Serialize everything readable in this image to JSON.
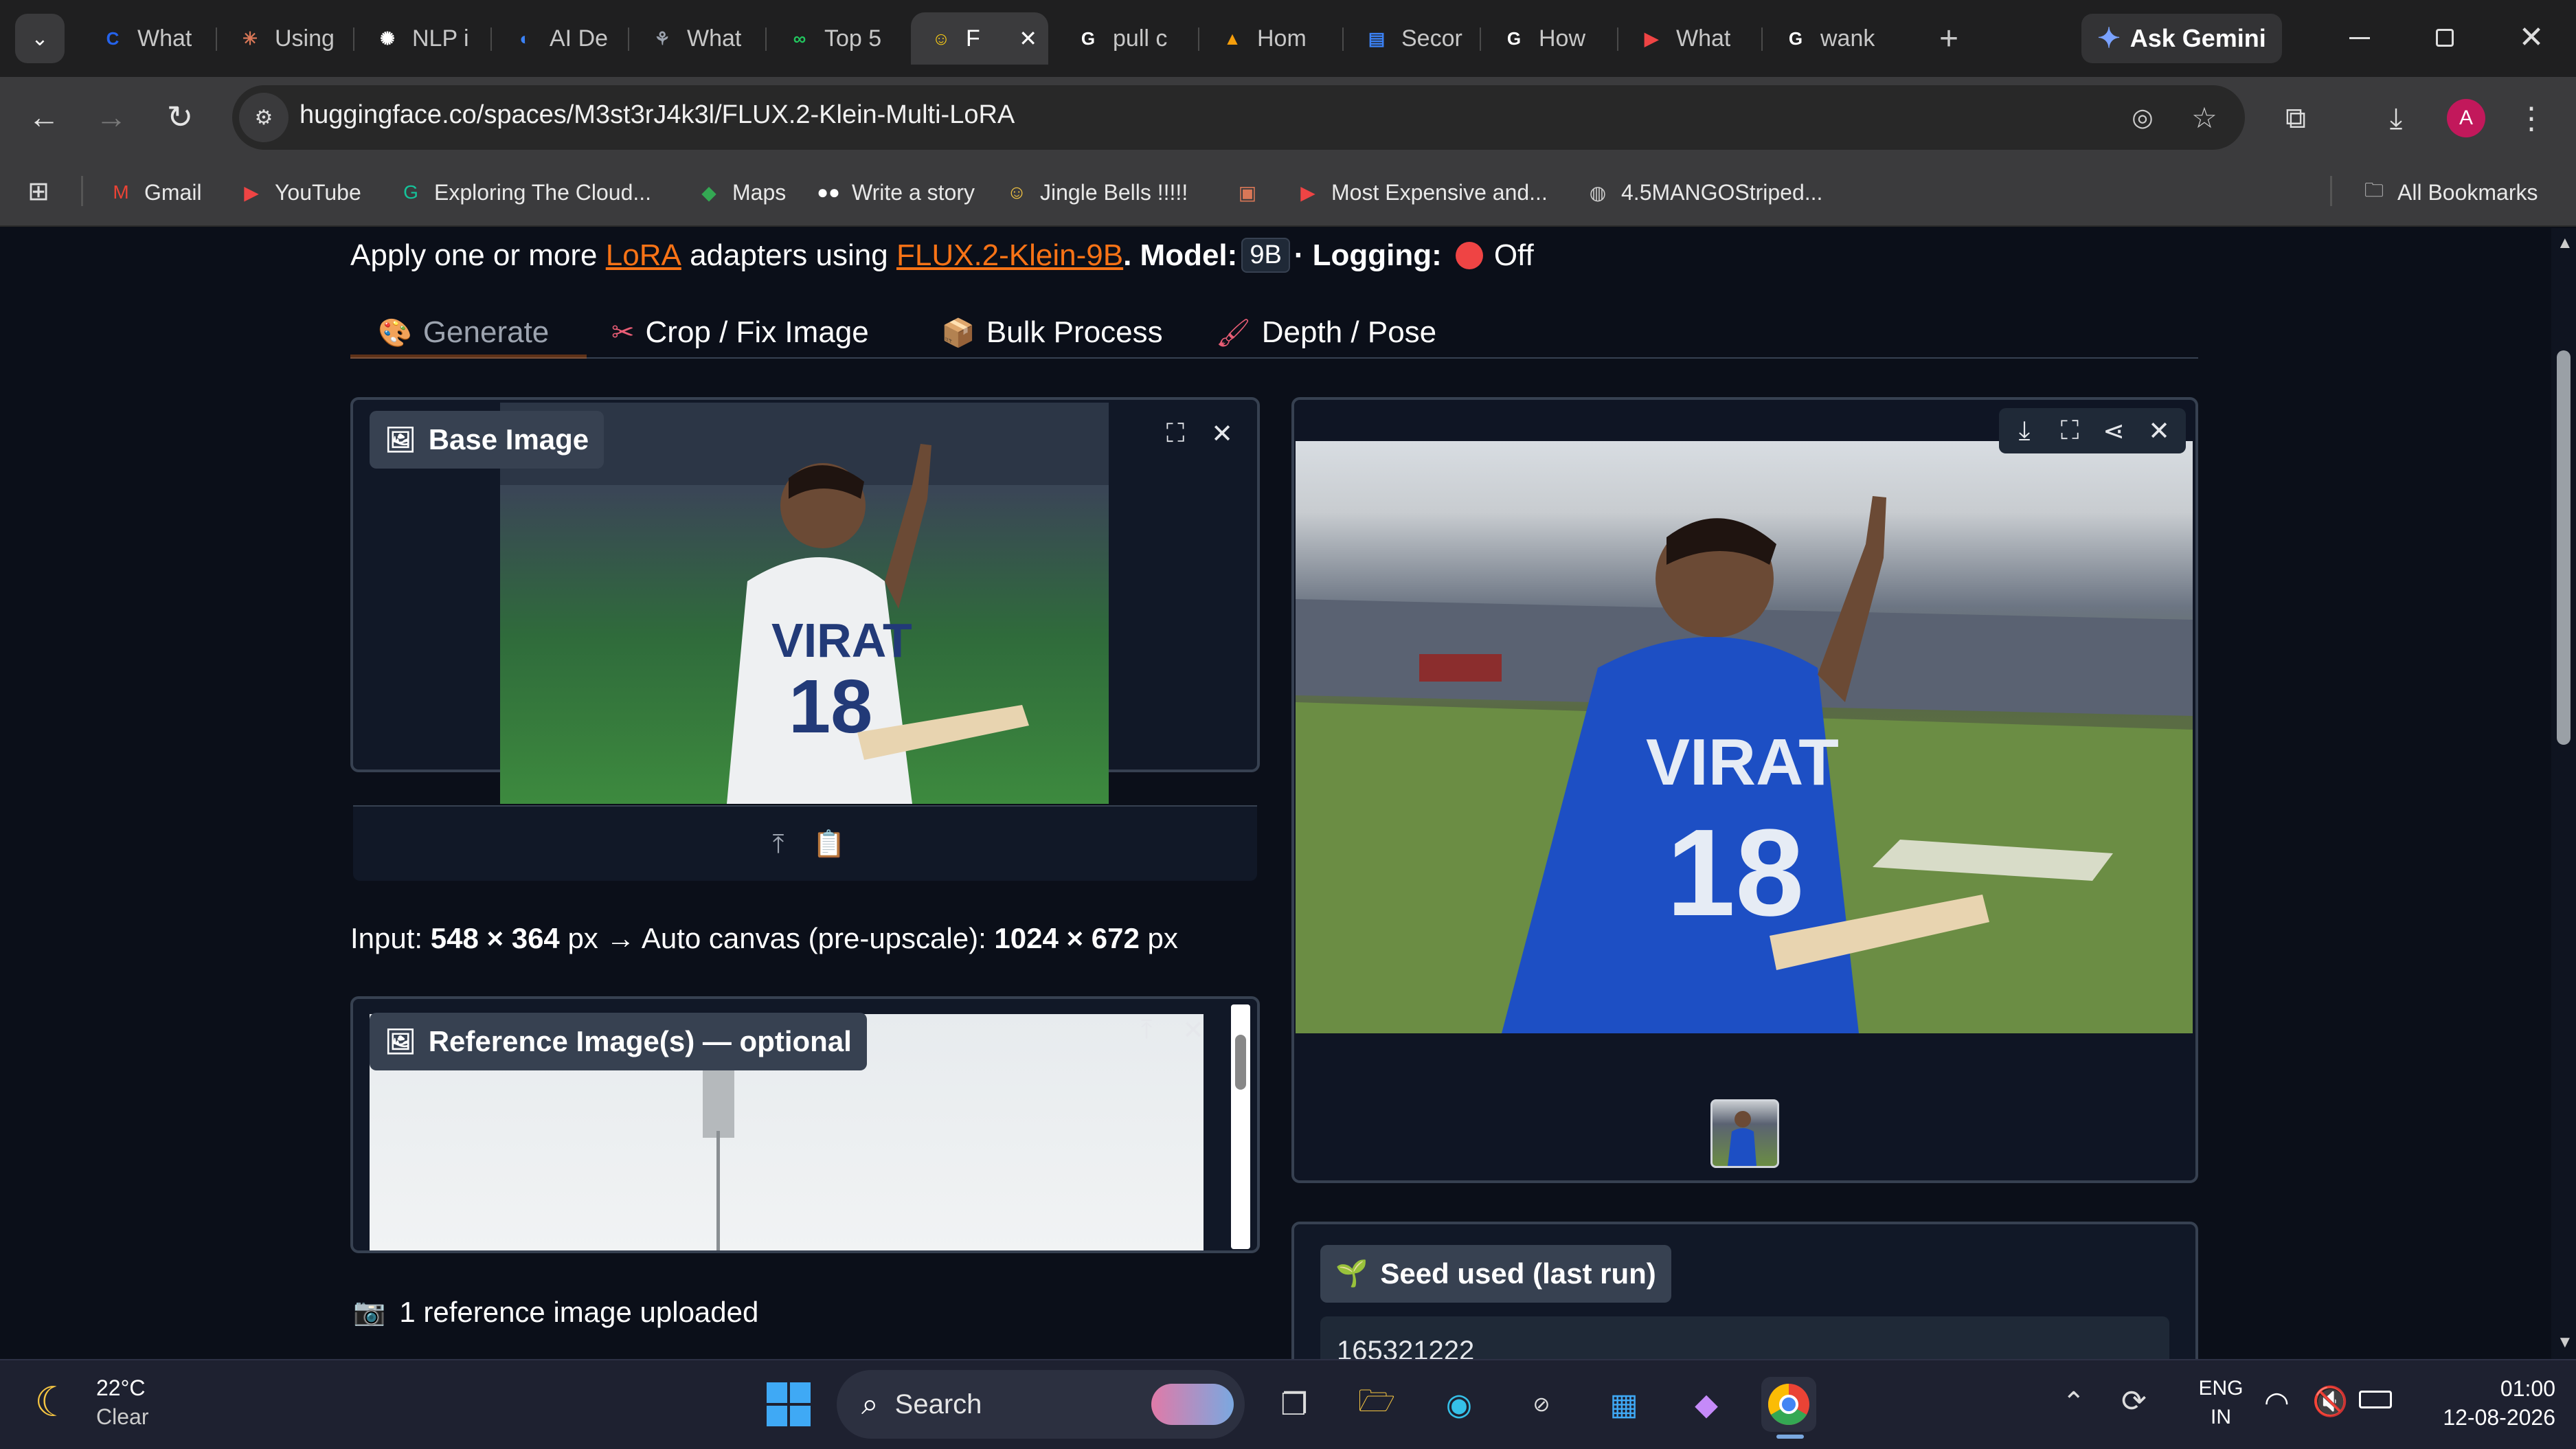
{
  "browser": {
    "tabs": [
      {
        "title": "What",
        "icon": "c-logo-icon",
        "color": "#2563eb"
      },
      {
        "title": "Using",
        "icon": "asterisk-icon",
        "color": "#d97757"
      },
      {
        "title": "NLP i",
        "icon": "openai-icon",
        "color": "#ffffff"
      },
      {
        "title": "AI De",
        "icon": "copilot-icon",
        "color": "#3b82f6"
      },
      {
        "title": "What",
        "icon": "network-icon",
        "color": "#9ca3af"
      },
      {
        "title": "Top 5",
        "icon": "glasses-icon",
        "color": "#22c55e"
      },
      {
        "title": "F",
        "icon": "hugging-face-icon",
        "color": "#facc15",
        "active": true
      },
      {
        "title": "pull c",
        "icon": "google-icon",
        "color": "#ffffff"
      },
      {
        "title": "Hom",
        "icon": "drive-icon",
        "color": "#f59e0b"
      },
      {
        "title": "Secor",
        "icon": "docs-icon",
        "color": "#3b82f6"
      },
      {
        "title": "How",
        "icon": "google-icon",
        "color": "#ffffff"
      },
      {
        "title": "What",
        "icon": "youtube-icon",
        "color": "#ef4444"
      },
      {
        "title": "wank",
        "icon": "google-icon",
        "color": "#ffffff"
      }
    ],
    "new_tab": "+",
    "ask_gemini": "Ask Gemini",
    "url": "huggingface.co/spaces/M3st3rJ4k3l/FLUX.2-Klein-Multi-LoRA",
    "profile_initial": "A",
    "bookmarks": [
      {
        "label": "Gmail",
        "icon": "gmail-icon"
      },
      {
        "label": "YouTube",
        "icon": "youtube-icon"
      },
      {
        "label": "Exploring The Cloud...",
        "icon": "grammarly-icon"
      },
      {
        "label": "Maps",
        "icon": "maps-pin-icon"
      },
      {
        "label": "Write a story",
        "icon": "medium-icon"
      },
      {
        "label": "Jingle Bells !!!!!",
        "icon": "emoji-icon"
      },
      {
        "label": "",
        "icon": "gift-icon"
      },
      {
        "label": "Most Expensive and...",
        "icon": "youtube-icon"
      },
      {
        "label": "4.5MANGOStriped...",
        "icon": "globe-icon"
      }
    ],
    "all_bookmarks": "All Bookmarks"
  },
  "page": {
    "intro_prefix": "Apply one or more",
    "lora_link": "LoRA",
    "intro_mid": "adapters using",
    "model_link": "FLUX.2-Klein-9B",
    "model_label": ". Model:",
    "model_value": "9B",
    "logging_label": "· Logging:",
    "logging_value": "Off",
    "tabs": [
      {
        "label": "Generate",
        "icon": "palette-icon",
        "active": true
      },
      {
        "label": "Crop / Fix Image",
        "icon": "scissors-icon"
      },
      {
        "label": "Bulk Process",
        "icon": "package-icon"
      },
      {
        "label": "Depth / Pose",
        "icon": "brush-icon"
      }
    ],
    "base_image_label": "Base Image",
    "input_info_prefix": "Input:",
    "input_size": "548 × 364",
    "input_unit": "px → Auto canvas (pre-upscale):",
    "canvas_size": "1024 × 672",
    "canvas_unit": "px",
    "reference_label": "Reference Image(s) — optional",
    "reference_status": "1 reference image uploaded",
    "seed_label": "Seed used (last run)",
    "seed_value": "165321222"
  },
  "taskbar": {
    "weather_temp": "22°C",
    "weather_desc": "Clear",
    "search_placeholder": "Search",
    "lang_top": "ENG",
    "lang_bottom": "IN",
    "time": "01:00",
    "date": "12-08-2026"
  }
}
